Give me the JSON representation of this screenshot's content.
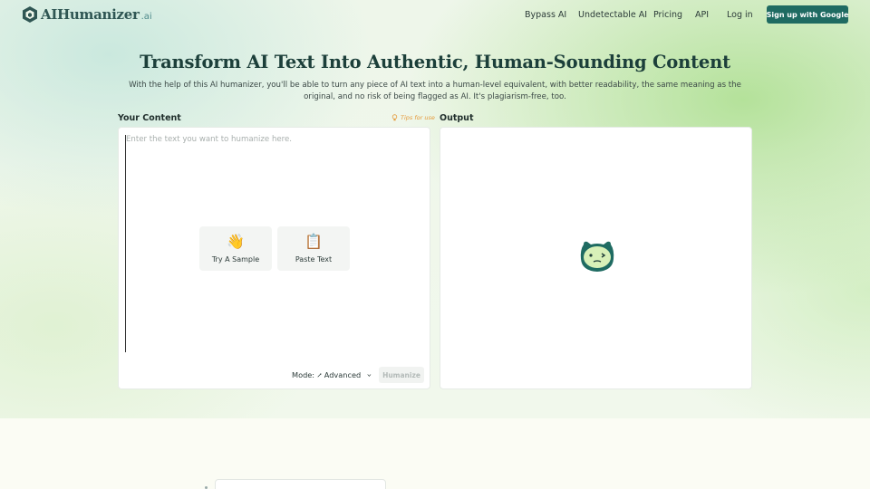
{
  "brand": {
    "name": "AIHumanizer",
    "suffix": ".ai"
  },
  "nav": {
    "links": [
      "Bypass AI",
      "Undetectable AI",
      "Pricing",
      "API",
      "Log in"
    ],
    "signup_label": "Sign up with Google"
  },
  "hero": {
    "title": "Transform AI Text Into Authentic, Human-Sounding Content",
    "subtitle": "With the help of this AI humanizer, you'll be able to turn any piece of AI text into a human-level equivalent, with better readability, the same meaning as the original, and no risk of being flagged as AI. It's plagiarism-free, too."
  },
  "input": {
    "label": "Your Content",
    "tips_label": "Tips for use",
    "placeholder": "Enter the text you want to humanize here.",
    "try_sample_label": "Try A Sample",
    "paste_text_label": "Paste Text",
    "mode_label": "Mode:",
    "mode_value": "Advanced",
    "humanize_label": "Humanize"
  },
  "output": {
    "label": "Output"
  },
  "icons": {
    "logo": "shield-hexagon-icon",
    "tips": "bulb-icon",
    "try_sample": "waving-hand-icon",
    "paste": "clipboard-icon",
    "mode": "magic-wand-icon",
    "chevron": "chevron-down-icon",
    "mascot": "robot-mascot-icon"
  },
  "colors": {
    "brand_dark": "#1f6b62",
    "accent_orange": "#e59a3a",
    "title": "#1c3f3a"
  }
}
